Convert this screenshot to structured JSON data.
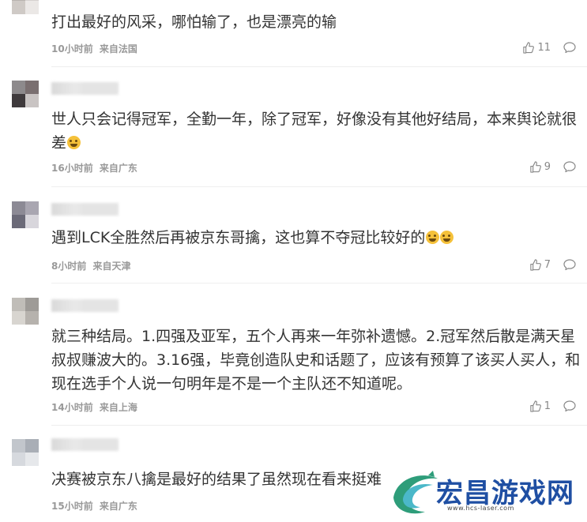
{
  "comments": [
    {
      "text": "打出最好的风采，哪怕输了，也是漂亮的输",
      "time": "10小时前",
      "location": "来自法国",
      "likes": "11",
      "emoji": ""
    },
    {
      "text": "世人只会记得冠军，全勤一年，除了冠军，好像没有其他好结局，本来舆论就很差",
      "time": "16小时前",
      "location": "来自广东",
      "likes": "9",
      "emoji": "crying-emoji"
    },
    {
      "text": "遇到LCK全胜然后再被京东哥擒，这也算不夺冠比较好的",
      "time": "8小时前",
      "location": "来自天津",
      "likes": "7",
      "emoji": "laughing-emoji"
    },
    {
      "text": "就三种结局。1.四强及亚军，五个人再来一年弥补遗憾。2.冠军然后散是满天星叔叔赚波大的。3.16强，毕竟创造队史和话题了，应该有预算了该买人买人，和现在选手个人说一句明年是不是一个主队还不知道呢。",
      "time": "14小时前",
      "location": "来自上海",
      "likes": "1",
      "emoji": ""
    },
    {
      "text": "决赛被京东八擒是最好的结果了虽然现在看来挺难",
      "time": "15小时前",
      "location": "来自广东",
      "likes": "",
      "emoji": ""
    }
  ],
  "watermark": {
    "title": "宏昌游戏网",
    "url": "www.hcs-laser.com"
  },
  "colors": {
    "text": "#333333",
    "meta": "#999999",
    "watermark": "#1f4fa3"
  }
}
